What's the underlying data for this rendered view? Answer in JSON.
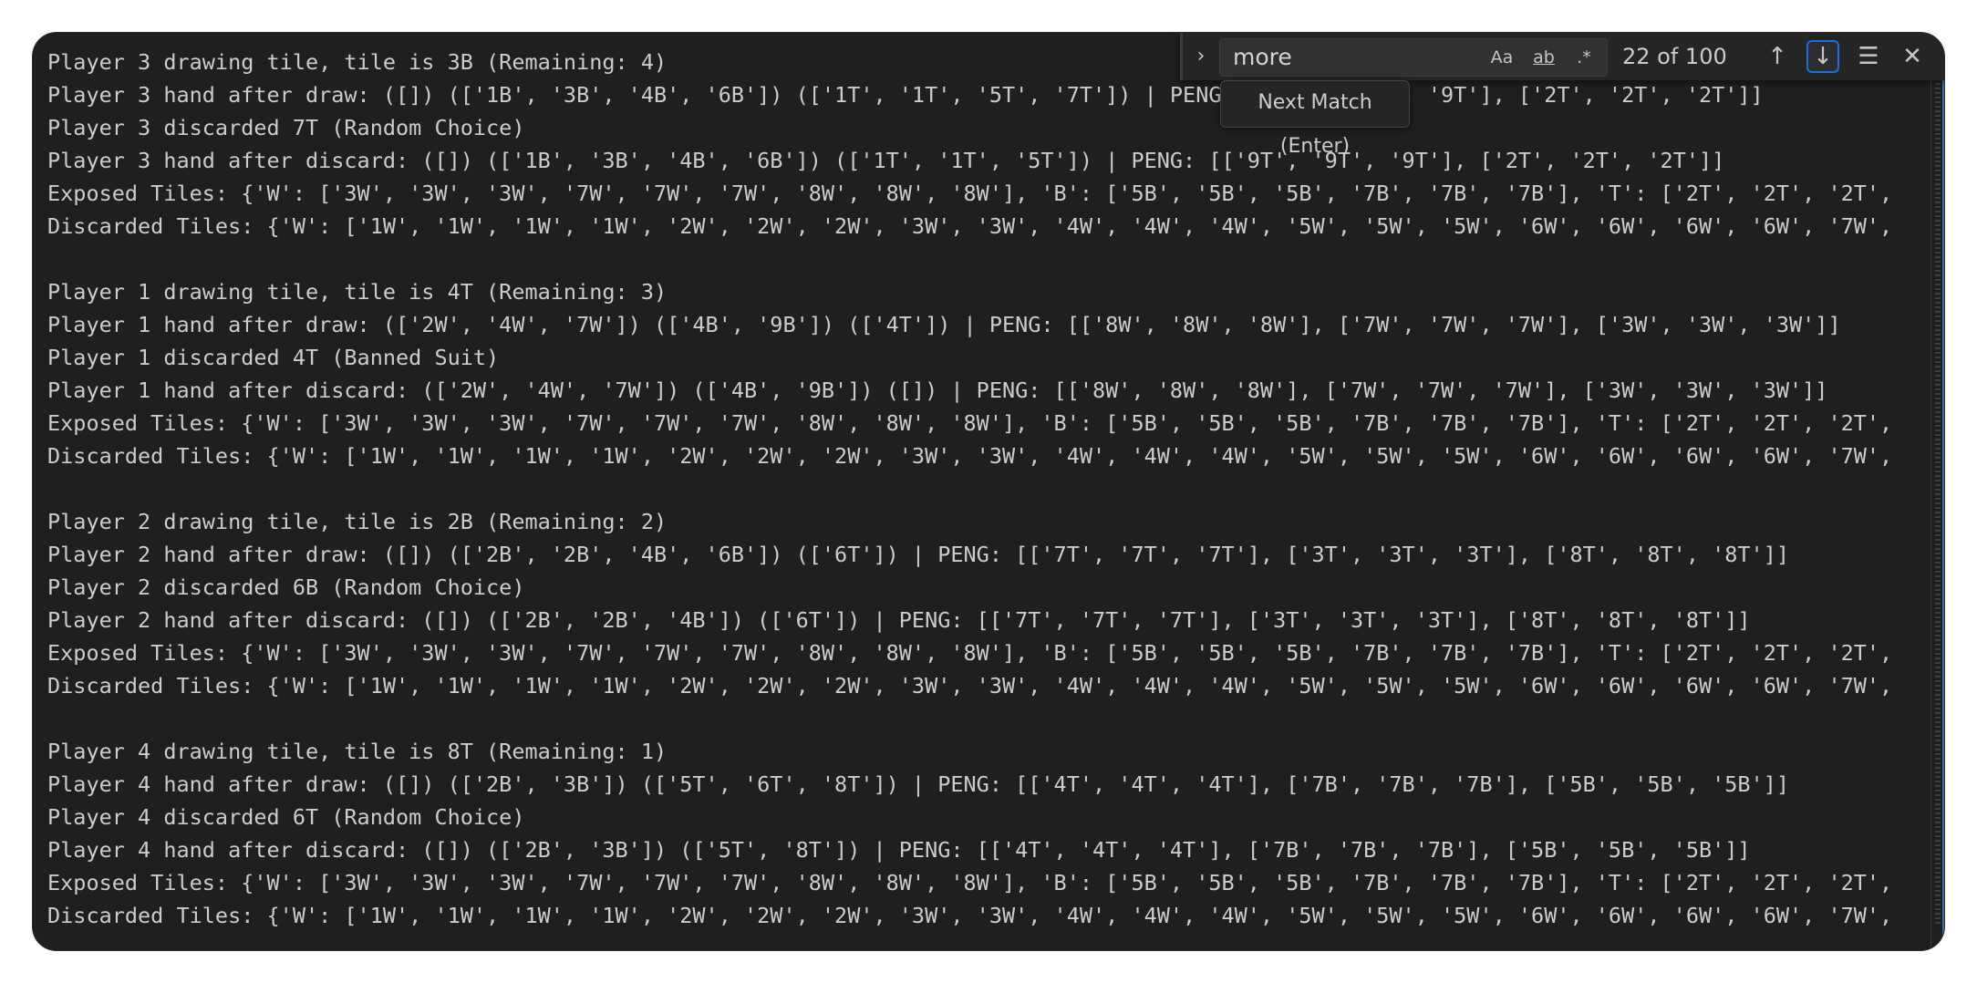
{
  "find_widget": {
    "query": "more",
    "match_case_label": "Aa",
    "whole_word_label": "ab",
    "regex_label": ".*",
    "count": "22 of 100",
    "tooltip": "Next Match (Enter)"
  },
  "terminal_lines": [
    "Player 3 drawing tile, tile is 3B (Remaining: 4)",
    "Player 3 hand after draw: ([]) (['1B', '3B', '4B', '6B']) (['1T', '1T', '5T', '7T']) | PENG: [['9T', '9T', '9T'], ['2T', '2T', '2T']]",
    "Player 3 discarded 7T (Random Choice)",
    "Player 3 hand after discard: ([]) (['1B', '3B', '4B', '6B']) (['1T', '1T', '5T']) | PENG: [['9T', '9T', '9T'], ['2T', '2T', '2T']]",
    "Exposed Tiles: {'W': ['3W', '3W', '3W', '7W', '7W', '7W', '8W', '8W', '8W'], 'B': ['5B', '5B', '5B', '7B', '7B', '7B'], 'T': ['2T', '2T', '2T',",
    "Discarded Tiles: {'W': ['1W', '1W', '1W', '1W', '2W', '2W', '2W', '3W', '3W', '4W', '4W', '4W', '5W', '5W', '5W', '6W', '6W', '6W', '6W', '7W',",
    "",
    "Player 1 drawing tile, tile is 4T (Remaining: 3)",
    "Player 1 hand after draw: (['2W', '4W', '7W']) (['4B', '9B']) (['4T']) | PENG: [['8W', '8W', '8W'], ['7W', '7W', '7W'], ['3W', '3W', '3W']]",
    "Player 1 discarded 4T (Banned Suit)",
    "Player 1 hand after discard: (['2W', '4W', '7W']) (['4B', '9B']) ([]) | PENG: [['8W', '8W', '8W'], ['7W', '7W', '7W'], ['3W', '3W', '3W']]",
    "Exposed Tiles: {'W': ['3W', '3W', '3W', '7W', '7W', '7W', '8W', '8W', '8W'], 'B': ['5B', '5B', '5B', '7B', '7B', '7B'], 'T': ['2T', '2T', '2T',",
    "Discarded Tiles: {'W': ['1W', '1W', '1W', '1W', '2W', '2W', '2W', '3W', '3W', '4W', '4W', '4W', '5W', '5W', '5W', '6W', '6W', '6W', '6W', '7W',",
    "",
    "Player 2 drawing tile, tile is 2B (Remaining: 2)",
    "Player 2 hand after draw: ([]) (['2B', '2B', '4B', '6B']) (['6T']) | PENG: [['7T', '7T', '7T'], ['3T', '3T', '3T'], ['8T', '8T', '8T']]",
    "Player 2 discarded 6B (Random Choice)",
    "Player 2 hand after discard: ([]) (['2B', '2B', '4B']) (['6T']) | PENG: [['7T', '7T', '7T'], ['3T', '3T', '3T'], ['8T', '8T', '8T']]",
    "Exposed Tiles: {'W': ['3W', '3W', '3W', '7W', '7W', '7W', '8W', '8W', '8W'], 'B': ['5B', '5B', '5B', '7B', '7B', '7B'], 'T': ['2T', '2T', '2T',",
    "Discarded Tiles: {'W': ['1W', '1W', '1W', '1W', '2W', '2W', '2W', '3W', '3W', '4W', '4W', '4W', '5W', '5W', '5W', '6W', '6W', '6W', '6W', '7W',",
    "",
    "Player 4 drawing tile, tile is 8T (Remaining: 1)",
    "Player 4 hand after draw: ([]) (['2B', '3B']) (['5T', '6T', '8T']) | PENG: [['4T', '4T', '4T'], ['7B', '7B', '7B'], ['5B', '5B', '5B']]",
    "Player 4 discarded 6T (Random Choice)",
    "Player 4 hand after discard: ([]) (['2B', '3B']) (['5T', '8T']) | PENG: [['4T', '4T', '4T'], ['7B', '7B', '7B'], ['5B', '5B', '5B']]",
    "Exposed Tiles: {'W': ['3W', '3W', '3W', '7W', '7W', '7W', '8W', '8W', '8W'], 'B': ['5B', '5B', '5B', '7B', '7B', '7B'], 'T': ['2T', '2T', '2T',",
    "Discarded Tiles: {'W': ['1W', '1W', '1W', '1W', '2W', '2W', '2W', '3W', '3W', '4W', '4W', '4W', '5W', '5W', '5W', '6W', '6W', '6W', '6W', '7W',"
  ]
}
